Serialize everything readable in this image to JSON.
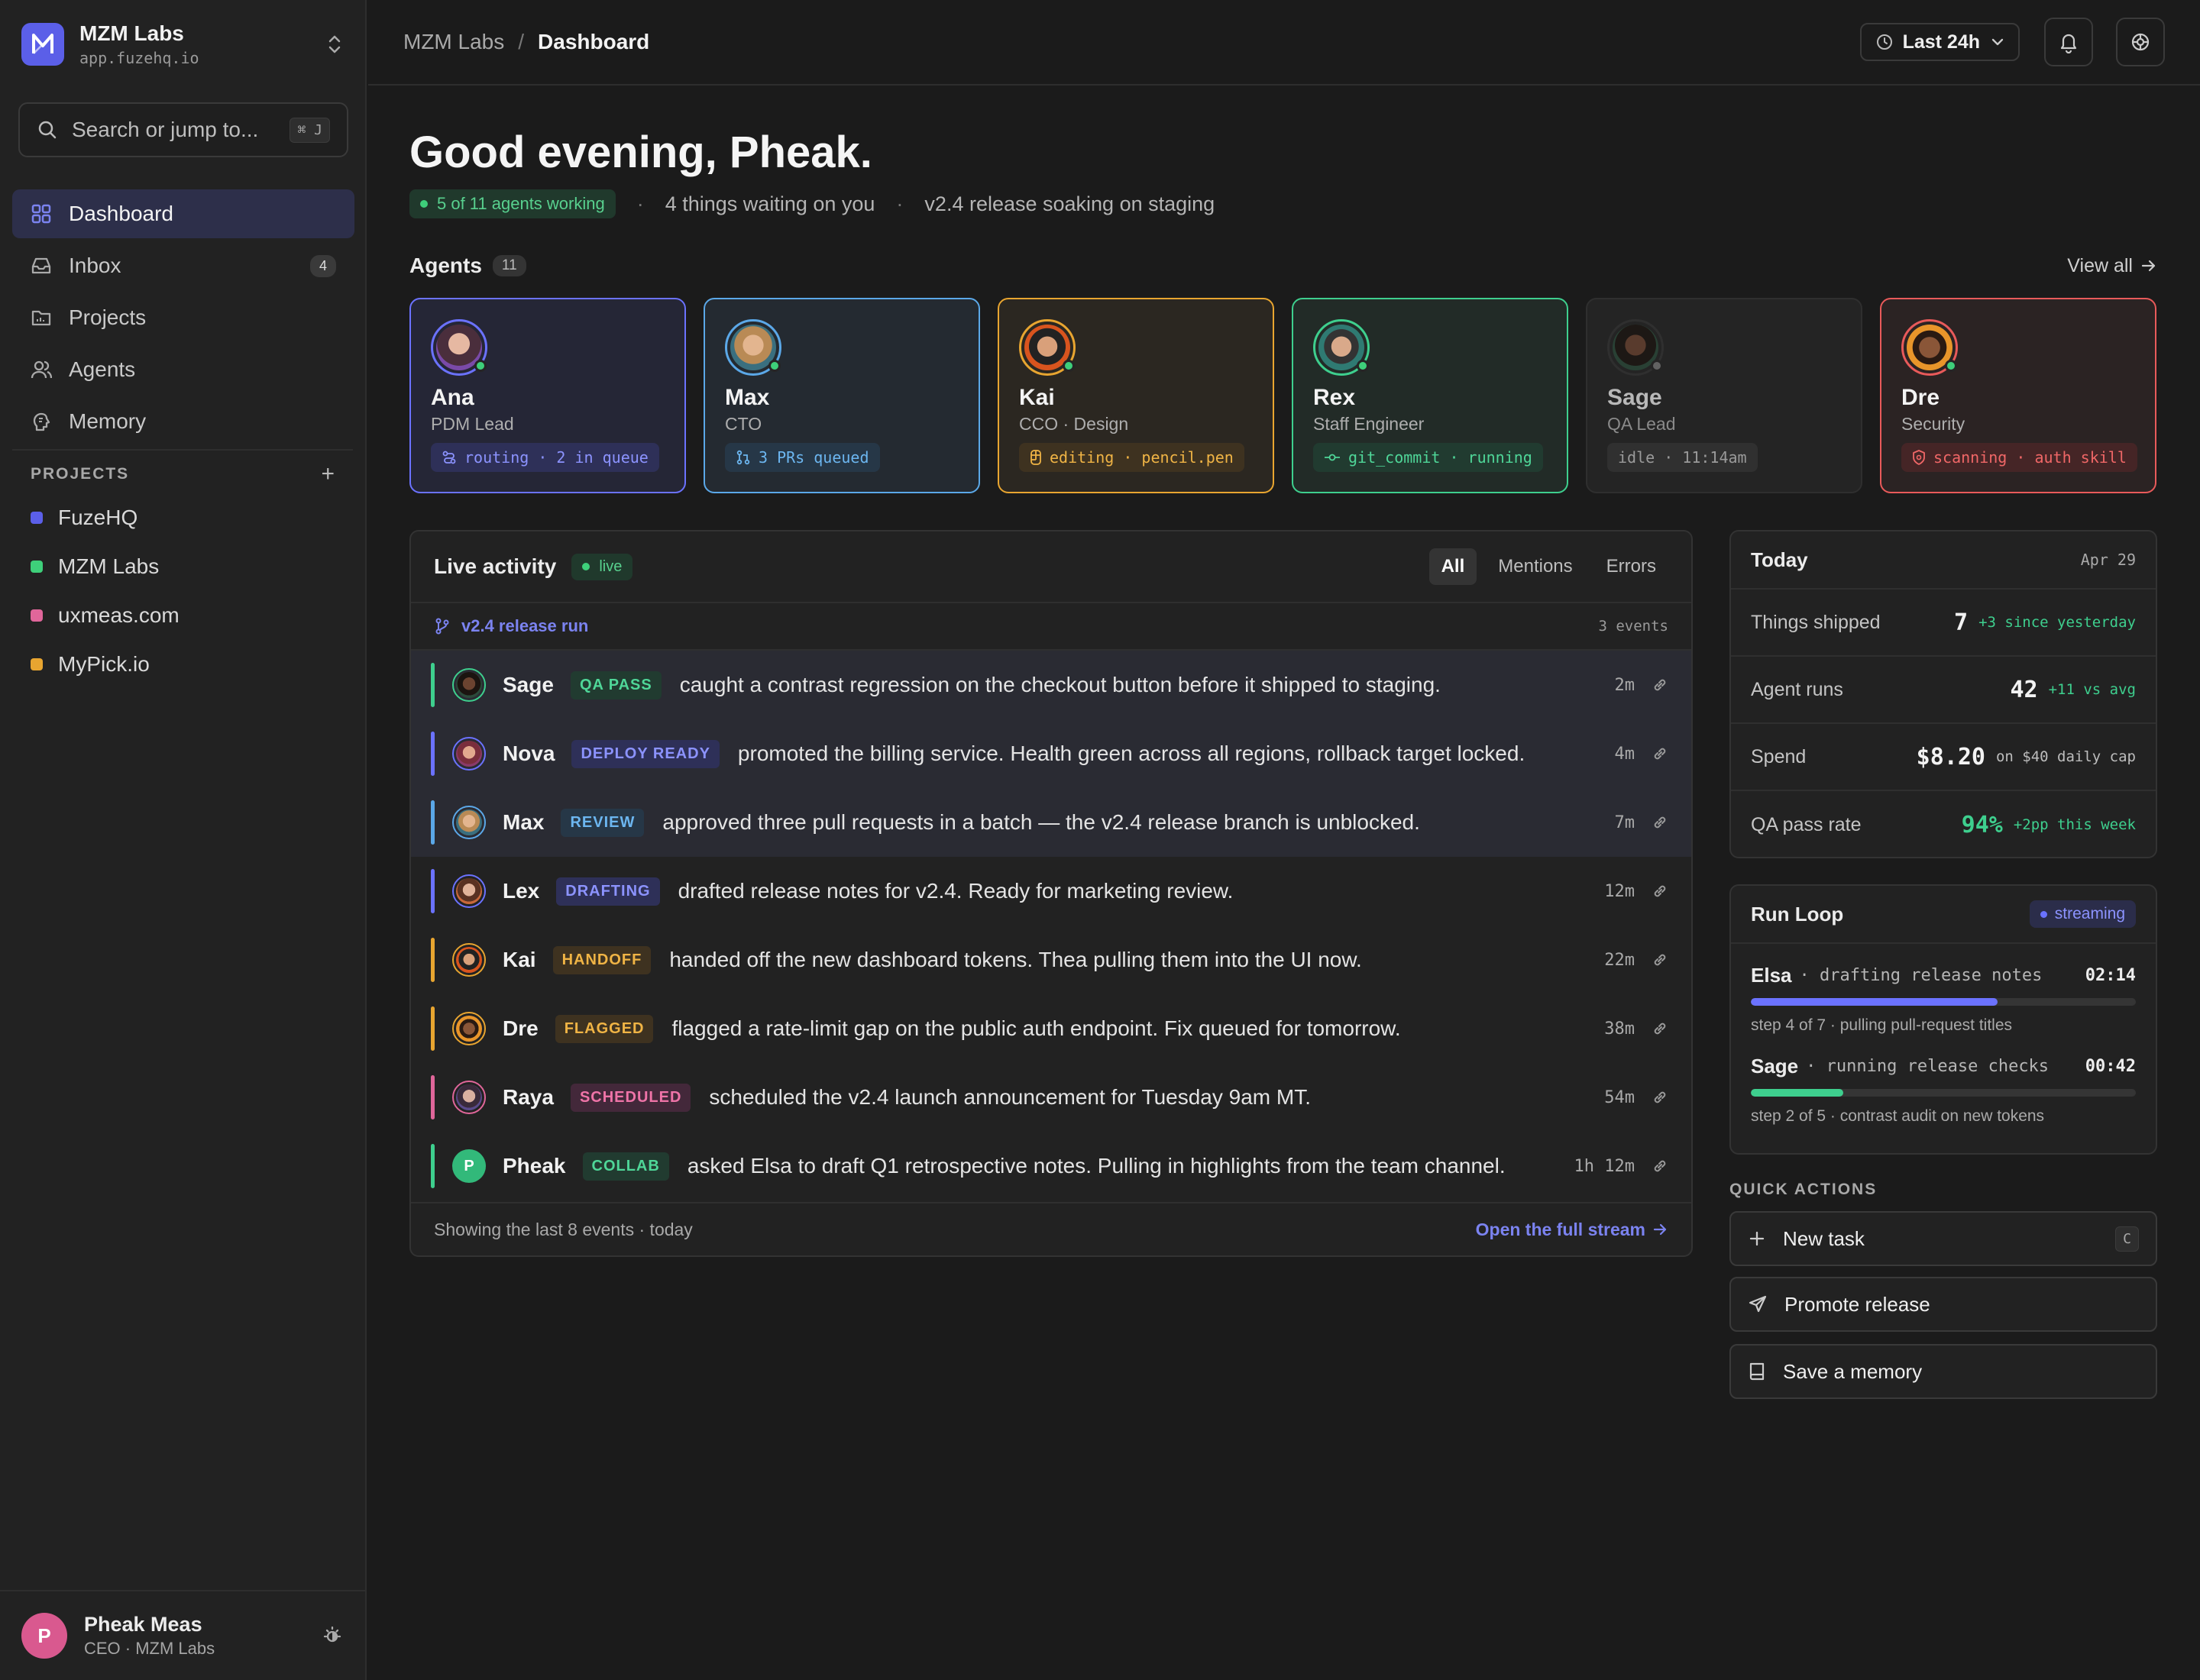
{
  "workspace": {
    "name": "MZM Labs",
    "url": "app.fuzehq.io"
  },
  "search": {
    "placeholder": "Search or jump to...",
    "shortcut": "⌘ J"
  },
  "nav": [
    {
      "label": "Dashboard",
      "icon": "grid-icon",
      "active": true
    },
    {
      "label": "Inbox",
      "icon": "inbox-icon",
      "count": "4"
    },
    {
      "label": "Projects",
      "icon": "folder-icon"
    },
    {
      "label": "Agents",
      "icon": "users-icon"
    },
    {
      "label": "Memory",
      "icon": "brain-icon"
    }
  ],
  "projects_header": "PROJECTS",
  "projects": [
    {
      "label": "FuzeHQ",
      "color": "#5b5fe8"
    },
    {
      "label": "MZM Labs",
      "color": "#3ecf7a"
    },
    {
      "label": "uxmeas.com",
      "color": "#e0669a"
    },
    {
      "label": "MyPick.io",
      "color": "#e8a530"
    }
  ],
  "user": {
    "initial": "P",
    "name": "Pheak Meas",
    "role": "CEO · MZM Labs"
  },
  "breadcrumb": {
    "parent": "MZM Labs",
    "separator": "/",
    "current": "Dashboard"
  },
  "time_range": "Last 24h",
  "greeting": "Good evening, Pheak.",
  "status": {
    "working": "5 of 11 agents working",
    "waiting": "4 things waiting on you",
    "release": "v2.4 release soaking on staging",
    "dot": "·"
  },
  "agents_section": {
    "title": "Agents",
    "count": "11",
    "view_all": "View all"
  },
  "agents": [
    {
      "name": "Ana",
      "role": "PDM Lead",
      "tag": "routing · 2 in queue",
      "color": "#6b72ff",
      "online": true
    },
    {
      "name": "Max",
      "role": "CTO",
      "tag": "3 PRs queued",
      "color": "#5ba8e8",
      "online": true
    },
    {
      "name": "Kai",
      "role": "CCO · Design",
      "tag": "editing · pencil.pen",
      "color": "#e8a530",
      "online": true
    },
    {
      "name": "Rex",
      "role": "Staff Engineer",
      "tag": "git_commit · running",
      "color": "#3ecf8e",
      "online": true
    },
    {
      "name": "Sage",
      "role": "QA Lead",
      "tag": "idle · 11:14am",
      "color": "#8a8a8a",
      "online": false
    },
    {
      "name": "Dre",
      "role": "Security",
      "tag": "scanning · auth skill",
      "color": "#e85a5a",
      "online": true
    }
  ],
  "activity": {
    "title": "Live activity",
    "live_label": "live",
    "filters": [
      "All",
      "Mentions",
      "Errors"
    ],
    "group": {
      "label": "v2.4 release run",
      "count": "3 events"
    },
    "events": [
      {
        "name": "Sage",
        "tag": "QA PASS",
        "text": "caught a contrast regression on the checkout button before it shipped to staging.",
        "time": "2m",
        "color": "#3ecf8e"
      },
      {
        "name": "Nova",
        "tag": "DEPLOY READY",
        "text": "promoted the billing service. Health green across all regions, rollback target locked.",
        "time": "4m",
        "color": "#6b72ff"
      },
      {
        "name": "Max",
        "tag": "REVIEW",
        "text": "approved three pull requests in a batch — the v2.4 release branch is unblocked.",
        "time": "7m",
        "color": "#5ba8e8"
      },
      {
        "name": "Lex",
        "tag": "DRAFTING",
        "text": "drafted release notes for v2.4. Ready for marketing review.",
        "time": "12m",
        "color": "#6b72ff"
      },
      {
        "name": "Kai",
        "tag": "HANDOFF",
        "text": "handed off the new dashboard tokens. Thea pulling them into the UI now.",
        "time": "22m",
        "color": "#e8a530"
      },
      {
        "name": "Dre",
        "tag": "FLAGGED",
        "text": "flagged a rate-limit gap on the public auth endpoint. Fix queued for tomorrow.",
        "time": "38m",
        "color": "#e8a530"
      },
      {
        "name": "Raya",
        "tag": "SCHEDULED",
        "text": "scheduled the v2.4 launch announcement for Tuesday 9am MT.",
        "time": "54m",
        "color": "#e0669a"
      },
      {
        "name": "Pheak",
        "tag": "COLLAB",
        "text": "asked Elsa to draft Q1 retrospective notes. Pulling in highlights from the team channel.",
        "time": "1h 12m",
        "color": "#3ecf8e",
        "initial": "P"
      }
    ],
    "footer": "Showing the last 8 events · today",
    "open_stream": "Open the full stream"
  },
  "today": {
    "title": "Today",
    "date": "Apr 29",
    "stats": [
      {
        "label": "Things shipped",
        "value": "7",
        "note": "+3 since yesterday",
        "note_color": "#3ecf8e"
      },
      {
        "label": "Agent runs",
        "value": "42",
        "note": "+11 vs avg",
        "note_color": "#3ecf8e"
      },
      {
        "label": "Spend",
        "value": "$8.20",
        "note": "on $40 daily cap",
        "note_color": "#bdbdbd"
      },
      {
        "label": "QA pass rate",
        "value": "94%",
        "note": "+2pp this week",
        "note_color": "#3ecf8e",
        "value_color": "#3ecf8e"
      }
    ]
  },
  "run_loop": {
    "title": "Run Loop",
    "badge": "streaming",
    "runs": [
      {
        "who": "Elsa",
        "what": "drafting release notes",
        "time": "02:14",
        "progress": 0.64,
        "step": "step 4 of 7 · pulling pull-request titles",
        "color": "#6b72ff"
      },
      {
        "who": "Sage",
        "what": "running release checks",
        "time": "00:42",
        "progress": 0.24,
        "step": "step 2 of 5 · contrast audit on new tokens",
        "color": "#3ecf8e"
      }
    ]
  },
  "quick_actions": {
    "title": "QUICK ACTIONS",
    "items": [
      {
        "label": "New task",
        "icon": "plus-icon",
        "shortcut": "C"
      },
      {
        "label": "Promote release",
        "icon": "send-icon"
      },
      {
        "label": "Save a memory",
        "icon": "book-icon"
      }
    ]
  }
}
